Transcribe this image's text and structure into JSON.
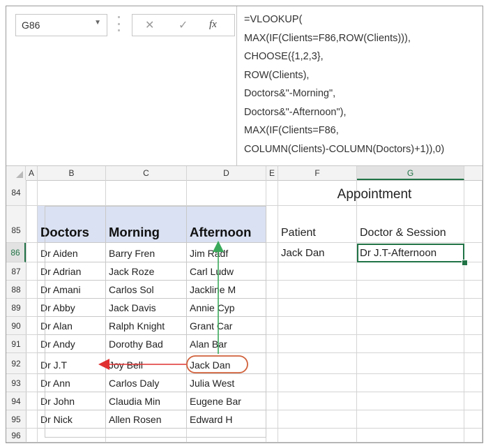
{
  "formula_bar": {
    "name_box": "G86",
    "dropdown_glyph": "▼",
    "cancel_glyph": "✕",
    "enter_glyph": "✓",
    "fx_label": "fx",
    "formula_lines": [
      "=VLOOKUP(",
      "MAX(IF(Clients=F86,ROW(Clients))),",
      "CHOOSE({1,2,3},",
      "ROW(Clients),",
      "Doctors&\"-Morning\",",
      "Doctors&\"-Afternoon\"),",
      "MAX(IF(Clients=F86,",
      "COLUMN(Clients)-COLUMN(Doctors)+1)),0)"
    ]
  },
  "columns": [
    "A",
    "B",
    "C",
    "D",
    "E",
    "F",
    "G"
  ],
  "selected_column": "G",
  "rows": [
    "84",
    "85",
    "86",
    "87",
    "88",
    "89",
    "90",
    "91",
    "92",
    "93",
    "94",
    "95",
    "96"
  ],
  "selected_row": "86",
  "table": {
    "headers": [
      "Doctors",
      "Morning",
      "Afternoon"
    ],
    "rows": [
      [
        "Dr Aiden",
        "Barry Fren",
        "Jim Radf"
      ],
      [
        "Dr Adrian",
        "Jack Roze",
        "Carl Ludw"
      ],
      [
        "Dr Amani",
        "Carlos Sol",
        "Jackline M"
      ],
      [
        "Dr Abby",
        "Jack Davis",
        "Annie Cyp"
      ],
      [
        "Dr Alan",
        "Ralph Knight",
        "Grant Car"
      ],
      [
        "Dr Andy",
        "Dorothy Bad",
        "Alan Bar"
      ],
      [
        "Dr J.T",
        "Joy Bell",
        "Jack Dan"
      ],
      [
        "Dr Ann",
        "Carlos Daly",
        "Julia West"
      ],
      [
        "Dr John",
        "Claudia Min",
        "Eugene Bar"
      ],
      [
        "Dr Nick",
        "Allen Rosen",
        "Edward H"
      ]
    ]
  },
  "appointment": {
    "title": "Appointment",
    "patient_label": "Patient",
    "doctor_session_label": "Doctor & Session",
    "patient_value": "Jack Dan",
    "result_value": "Dr J.T-Afternoon"
  },
  "colors": {
    "header_fill": "#d9e1f2",
    "selection_green": "#217346",
    "arrow_green": "#3aaa5a",
    "arrow_red": "#e03030",
    "highlight_oval": "#d0603a"
  }
}
